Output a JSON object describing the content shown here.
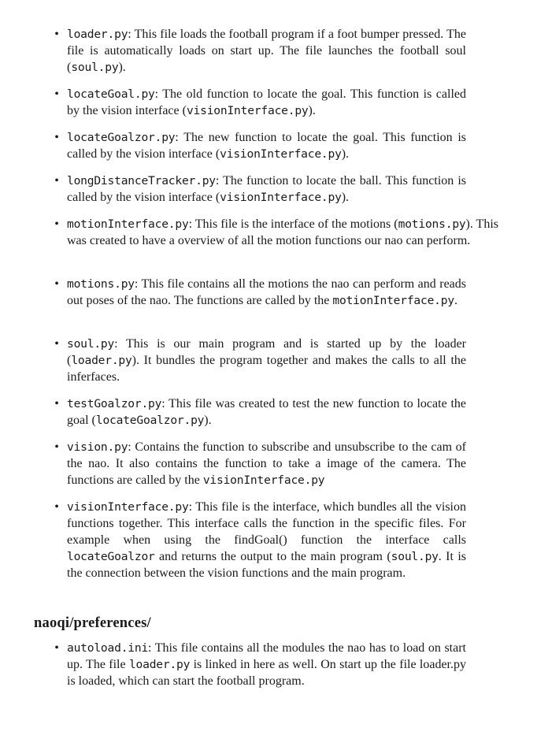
{
  "items": [
    {
      "seg": [
        {
          "m": "loader.py"
        },
        {
          "t": ": This file loads the football program if a foot bumper pressed. The file is automatically loads on start up. The file launches the football soul ("
        },
        {
          "m": "soul.py"
        },
        {
          "t": ")."
        }
      ]
    },
    {
      "seg": [
        {
          "m": "locateGoal.py"
        },
        {
          "t": ": The old function to locate the goal. This function is called by the vision interface ("
        },
        {
          "m": "visionInterface.py"
        },
        {
          "t": ")."
        }
      ]
    },
    {
      "seg": [
        {
          "m": "locateGoalzor.py"
        },
        {
          "t": ": The new function to locate the goal. This function is called by the vision interface ("
        },
        {
          "m": "visionInterface.py"
        },
        {
          "t": ")."
        }
      ]
    },
    {
      "seg": [
        {
          "m": "longDistanceTracker.py"
        },
        {
          "t": ": The function to locate the ball. This function is called by the vision interface ("
        },
        {
          "m": "visionInterface.py"
        },
        {
          "t": ")."
        }
      ]
    },
    {
      "seg": [
        {
          "m": "motionInterface.py"
        },
        {
          "t": ": This file is the interface of the motions ("
        },
        {
          "m": "motions.py"
        },
        {
          "t": "). This was created to have a overview of all the motion functions our nao can perform."
        }
      ]
    },
    {
      "seg": [
        {
          "m": "motions.py"
        },
        {
          "t": ": This file contains all the motions the nao can perform and reads out poses of the nao. The functions are called by the "
        },
        {
          "m": "motionInterface.py"
        },
        {
          "t": "."
        }
      ]
    },
    {
      "seg": [
        {
          "m": "soul.py"
        },
        {
          "t": ": This is our main program and is started up by the loader ("
        },
        {
          "m": "loader.py"
        },
        {
          "t": "). It bundles the program together and makes the calls to all the inferfaces."
        }
      ]
    },
    {
      "seg": [
        {
          "m": "testGoalzor.py"
        },
        {
          "t": ": This file was created to test the new function to locate the goal ("
        },
        {
          "m": "locateGoalzor.py"
        },
        {
          "t": ")."
        }
      ]
    },
    {
      "seg": [
        {
          "m": "vision.py"
        },
        {
          "t": ": Contains the function to subscribe and unsubscribe to the cam of the nao. It also contains the function to take a image of the camera. The functions are called by the "
        },
        {
          "m": "visionInterface.py"
        }
      ]
    },
    {
      "seg": [
        {
          "m": "visionInterface.py"
        },
        {
          "t": ": This file is the interface, which bundles all the vision functions together. This interface calls the function in the specific files. For example when using the findGoal() function the interface calls "
        },
        {
          "m": "locateGoalzor"
        },
        {
          "t": " and returns the output to the main program ("
        },
        {
          "m": "soul.py"
        },
        {
          "t": ". It is the connection between the vision functions and the main program."
        }
      ]
    }
  ],
  "heading": "naoqi/preferences/",
  "items2": [
    {
      "seg": [
        {
          "m": "autoload.ini"
        },
        {
          "t": ": This file contains all the modules the nao has to load on start up. The file "
        },
        {
          "m": "loader.py"
        },
        {
          "t": " is linked in here as well. On start up the file loader.py is loaded, which can start the football program."
        }
      ]
    }
  ]
}
